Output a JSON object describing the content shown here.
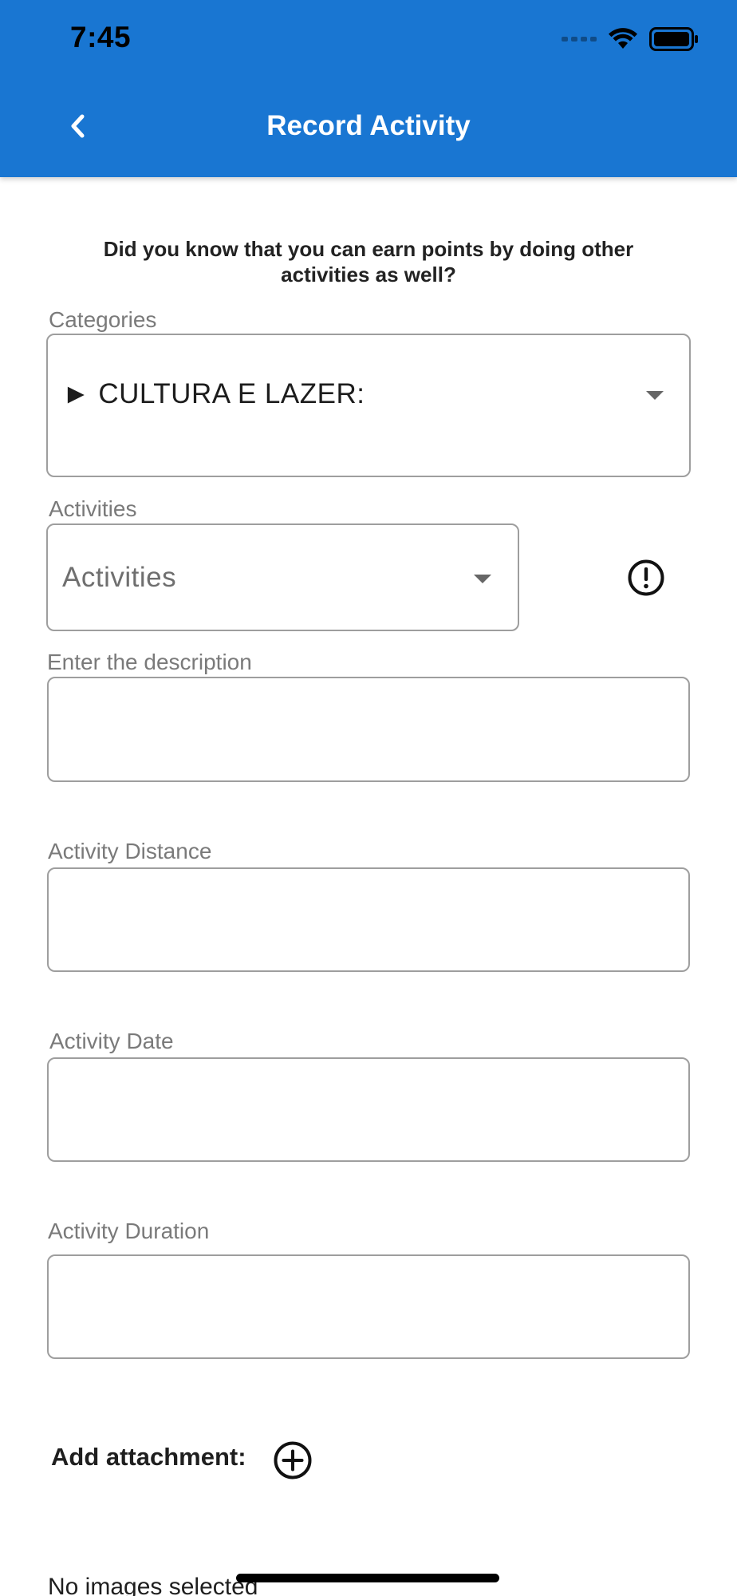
{
  "status_bar": {
    "time": "7:45"
  },
  "header": {
    "title": "Record Activity",
    "background_color": "#1976d2"
  },
  "intro": {
    "text": "Did you know that you can earn points by doing other activities as well?"
  },
  "categories": {
    "label": "Categories",
    "selected_value": "► CULTURA E LAZER:"
  },
  "activities": {
    "label": "Activities",
    "placeholder": "Activities"
  },
  "description": {
    "label": "Enter the description",
    "value": ""
  },
  "distance": {
    "label": "Activity Distance",
    "value": ""
  },
  "date": {
    "label": "Activity Date",
    "value": ""
  },
  "duration": {
    "label": "Activity Duration",
    "value": ""
  },
  "attachment": {
    "label": "Add attachment:",
    "empty_text": "No images selected"
  },
  "icons": {
    "back": "chevron-left-icon",
    "dropdown": "caret-down-icon",
    "info": "exclamation-circle-icon",
    "add": "plus-circle-icon",
    "wifi": "wifi-icon",
    "battery": "battery-icon"
  }
}
